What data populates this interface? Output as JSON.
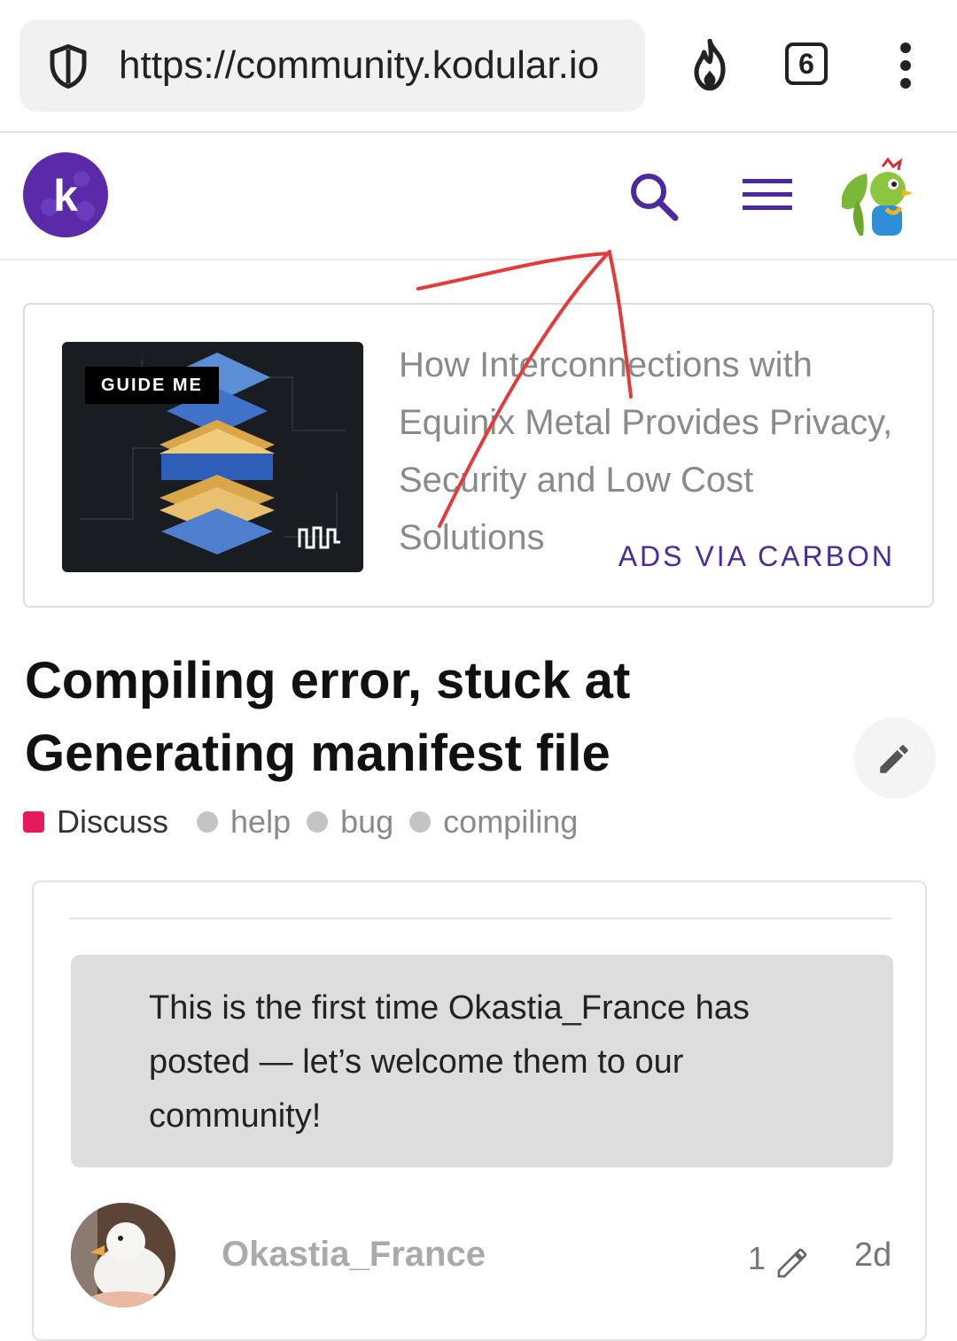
{
  "browser": {
    "url": "https://community.kodular.io",
    "tab_count": "6",
    "icons": [
      "shield-icon",
      "flame-icon",
      "tabs-counter-icon",
      "more-vert-icon"
    ]
  },
  "site_header": {
    "logo_letter": "k",
    "icons": [
      "search-icon",
      "hamburger-menu-icon",
      "user-avatar"
    ]
  },
  "ad": {
    "image_tag": "GUIDE ME",
    "image_mark": "Equinix logo",
    "text": "How Interconnections with Equinix Metal Provides Privacy, Security and Low Cost Solutions",
    "via": "ADS VIA CARBON"
  },
  "topic": {
    "title": "Compiling error, stuck at Generating manifest file",
    "category": "Discuss",
    "tags": [
      "help",
      "bug",
      "compiling"
    ]
  },
  "post": {
    "welcome_notice": "This is the first time Okastia_France has posted — let’s welcome them to our community!",
    "username": "Okastia_France",
    "edit_count": "1",
    "age": "2d"
  },
  "colors": {
    "brand_purple": "#4a2a9e",
    "category_color": "#e6195b",
    "annotation_red": "#e53a3a"
  }
}
